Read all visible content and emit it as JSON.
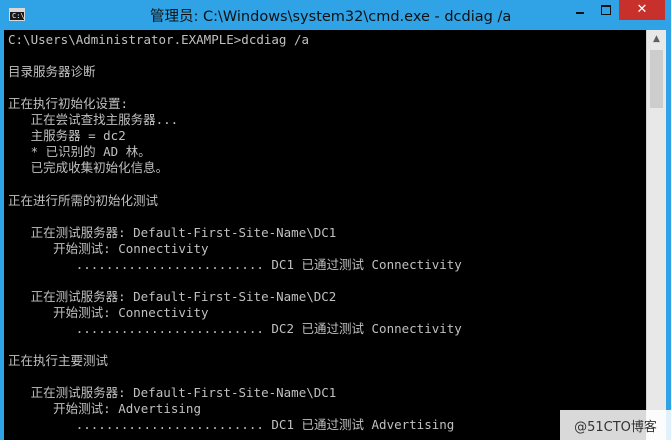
{
  "window": {
    "title": "管理员: C:\\Windows\\system32\\cmd.exe - dcdiag  /a",
    "icon_prompt": "C:\\",
    "controls": {
      "minimize": "minimize-icon",
      "maximize": "maximize-icon",
      "close": "✕"
    }
  },
  "console": {
    "lines": [
      "C:\\Users\\Administrator.EXAMPLE>dcdiag /a",
      "",
      "目录服务器诊断",
      "",
      "正在执行初始化设置:",
      "   正在尝试查找主服务器...",
      "   主服务器 = dc2",
      "   * 已识别的 AD 林。",
      "   已完成收集初始化信息。",
      "",
      "正在进行所需的初始化测试",
      "",
      "   正在测试服务器: Default-First-Site-Name\\DC1",
      "      开始测试: Connectivity",
      "         ......................... DC1 已通过测试 Connectivity",
      "",
      "   正在测试服务器: Default-First-Site-Name\\DC2",
      "      开始测试: Connectivity",
      "         ......................... DC2 已通过测试 Connectivity",
      "",
      "正在执行主要测试",
      "",
      "   正在测试服务器: Default-First-Site-Name\\DC1",
      "      开始测试: Advertising",
      "         ......................... DC1 已通过测试 Advertising"
    ]
  },
  "watermark": "@51CTO博客",
  "colors": {
    "titlebar": "#2fa3e6",
    "console_bg": "#000000",
    "console_text": "#c0c0c0",
    "close_button": "#c7302b"
  }
}
